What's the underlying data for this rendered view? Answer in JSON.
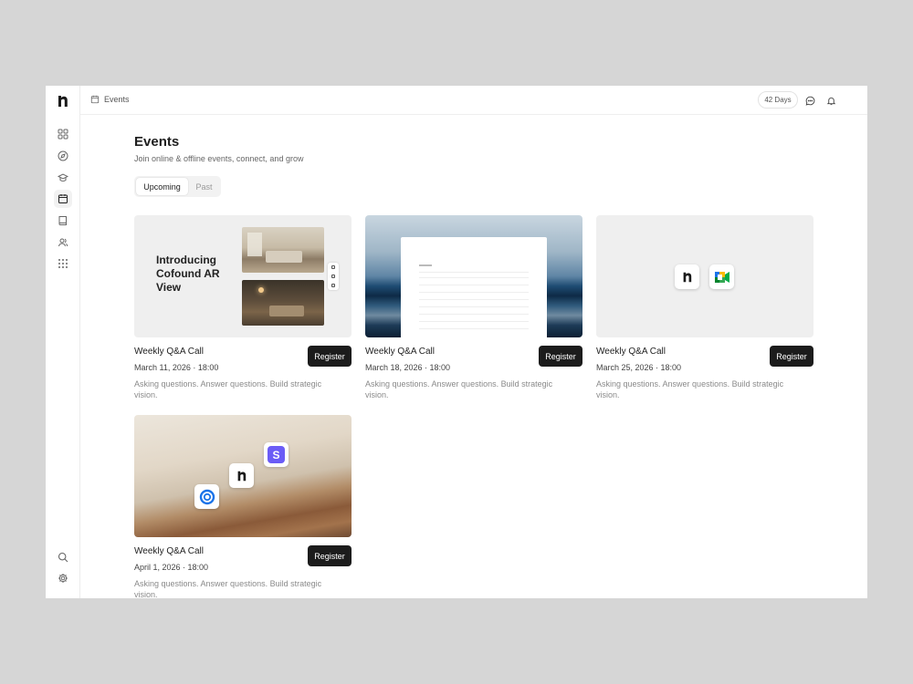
{
  "breadcrumb": {
    "label": "Events"
  },
  "topbar": {
    "days_badge": "42 Days"
  },
  "page": {
    "title": "Events",
    "subtitle": "Join online & offline events, connect, and grow",
    "tabs": [
      {
        "label": "Upcoming",
        "active": true
      },
      {
        "label": "Past",
        "active": false
      }
    ]
  },
  "sidebar": {
    "items": [
      {
        "icon": "dashboard-icon"
      },
      {
        "icon": "compass-icon"
      },
      {
        "icon": "graduation-cap-icon"
      },
      {
        "icon": "calendar-icon",
        "active": true
      },
      {
        "icon": "book-icon"
      },
      {
        "icon": "users-icon"
      },
      {
        "icon": "apps-grid-icon"
      }
    ],
    "bottom": [
      {
        "icon": "search-icon"
      },
      {
        "icon": "settings-icon"
      }
    ]
  },
  "events": [
    {
      "title": "Weekly Q&A Call",
      "date": "March 11, 2026 · 18:00",
      "description": "Asking questions. Answer questions. Build strategic vision.",
      "button": "Register",
      "thumb_text": "Introducing Cofound AR View"
    },
    {
      "title": "Weekly Q&A Call",
      "date": "March 18, 2026 · 18:00",
      "description": "Asking questions. Answer questions. Build strategic vision.",
      "button": "Register"
    },
    {
      "title": "Weekly Q&A Call",
      "date": "March 25, 2026 · 18:00",
      "description": "Asking questions. Answer questions. Build strategic vision.",
      "button": "Register"
    },
    {
      "title": "Weekly Q&A Call",
      "date": "April 1, 2026 · 18:00",
      "description": "Asking questions. Answer questions. Build strategic vision.",
      "button": "Register",
      "thumb_letter": "S"
    }
  ],
  "colors": {
    "button": "#1c1c1c",
    "background": "#d6d6d6",
    "accent_purple": "#6b5cf6",
    "accent_blue": "#1a73e8"
  }
}
